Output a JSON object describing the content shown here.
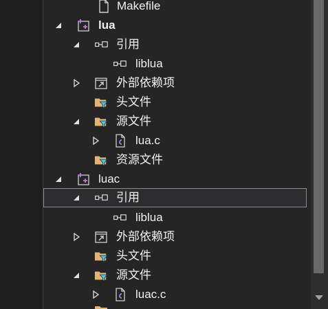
{
  "tree": {
    "items": [
      {
        "label": "Makefile"
      },
      {
        "label": "lua"
      },
      {
        "label": "引用"
      },
      {
        "label": "liblua"
      },
      {
        "label": "外部依赖项"
      },
      {
        "label": "头文件"
      },
      {
        "label": "源文件"
      },
      {
        "label": "lua.c"
      },
      {
        "label": "资源文件"
      },
      {
        "label": "luac"
      },
      {
        "label": "引用"
      },
      {
        "label": "liblua"
      },
      {
        "label": "外部依赖项"
      },
      {
        "label": "头文件"
      },
      {
        "label": "源文件"
      },
      {
        "label": "luac.c"
      }
    ]
  },
  "colors": {
    "background": "#1e1e1e",
    "pane": "#252526",
    "text": "#f1f1f1",
    "folder": "#dcb67a",
    "filter": "#4fc1e9",
    "project": "#b180d7",
    "selected_border": "#8a8a8a",
    "scroll_thumb": "#686868"
  }
}
